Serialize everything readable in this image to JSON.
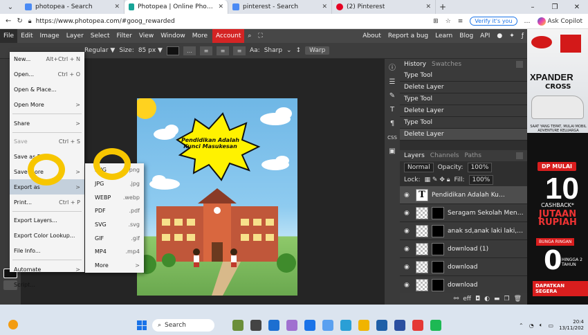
{
  "browser": {
    "tabs": [
      {
        "title": "photopea - Search",
        "color": "#4a8af4"
      },
      {
        "title": "Photopea | Online Photo Editor",
        "color": "#18a497",
        "active": true
      },
      {
        "title": "pinterest - Search",
        "color": "#4a8af4"
      },
      {
        "title": "(2) Pinterest",
        "color": "#e60023"
      }
    ],
    "url": "https://www.photopea.com/#goog_rewarded",
    "verify_label": "Verify it's you",
    "copilot_label": "Ask Copilot",
    "win_min": "–",
    "win_max": "❐",
    "win_close": "✕"
  },
  "menubar": {
    "items": [
      "File",
      "Edit",
      "Image",
      "Layer",
      "Select",
      "Filter",
      "View",
      "Window",
      "More"
    ],
    "account": "Account",
    "right_items": [
      "About",
      "Report a bug",
      "Learn",
      "Blog",
      "API"
    ]
  },
  "options": {
    "style": "Regular ▼",
    "size_label": "Size:",
    "size_value": "85 px ▼",
    "aa_label": "Aa:",
    "aa_value": "Sharp",
    "warp": "Warp",
    "color": "#111111"
  },
  "file_menu": {
    "items": [
      {
        "label": "New...",
        "shortcut": "Alt+Ctrl + N"
      },
      {
        "label": "Open...",
        "shortcut": "Ctrl + O"
      },
      {
        "label": "Open & Place...",
        "shortcut": ""
      },
      {
        "label": "Open More",
        "shortcut": ">"
      },
      {
        "label": "Share",
        "shortcut": ">"
      },
      {
        "label": "Save",
        "shortcut": "Ctrl + S",
        "disabled": true
      },
      {
        "label": "Save as PSD",
        "shortcut": ""
      },
      {
        "label": "Save more",
        "shortcut": ">"
      },
      {
        "label": "Export as",
        "shortcut": ">",
        "highlight": true
      },
      {
        "label": "Print...",
        "shortcut": "Ctrl + P"
      },
      {
        "label": "Export Layers...",
        "shortcut": ""
      },
      {
        "label": "Export Color Lookup...",
        "shortcut": ""
      },
      {
        "label": "File Info...",
        "shortcut": ""
      },
      {
        "label": "Automate",
        "shortcut": ">"
      },
      {
        "label": "Script...",
        "shortcut": ""
      }
    ]
  },
  "export_submenu": {
    "items": [
      {
        "label": "PNG",
        "ext": ".png"
      },
      {
        "label": "JPG",
        "ext": ".jpg"
      },
      {
        "label": "WEBP",
        "ext": ".webp"
      },
      {
        "label": "PDF",
        "ext": ".pdf"
      },
      {
        "label": "SVG",
        "ext": ".svg"
      },
      {
        "label": "GIF",
        "ext": ".gif"
      },
      {
        "label": "MP4",
        "ext": ".mp4"
      },
      {
        "label": "More",
        "ext": ">"
      }
    ]
  },
  "canvas": {
    "title_text": "Pendidikan Adalah Kunci Masukesan",
    "burst_color": "#fff200"
  },
  "history_panel": {
    "tabs": [
      "History",
      "Swatches"
    ],
    "items": [
      "Type Tool",
      "Delete Layer",
      "Type Tool",
      "Delete Layer",
      "Type Tool",
      "Delete Layer"
    ]
  },
  "layers_panel": {
    "tabs": [
      "Layers",
      "Channels",
      "Paths"
    ],
    "blend": "Normal",
    "opacity_label": "Opacity:",
    "opacity": "100%",
    "lock_label": "Lock:",
    "fill_label": "Fill:",
    "fill": "100%",
    "layers": [
      {
        "name": "Pendidikan Adalah Kunci",
        "type": "text",
        "selected": true
      },
      {
        "name": "Seragam Sekolah Meneg",
        "type": "image"
      },
      {
        "name": "anak sd,anak laki laki,kar",
        "type": "image"
      },
      {
        "name": "download (1)",
        "type": "image"
      },
      {
        "name": "download",
        "type": "image"
      },
      {
        "name": "download",
        "type": "image"
      }
    ],
    "footer": "eff"
  },
  "ad": {
    "brand": "XPANDER",
    "brand2": "CROSS",
    "tagline": "SAAT YANG TEPAT, MULAI MOBIL ADVENTURE KELUARGA",
    "dp_label": "DP MULAI",
    "dp_value": "10",
    "cashback": "CASHBACK*",
    "jutaan": "JUTAAN RUPIAH",
    "bunga": "BUNGA RINGAN",
    "zero": "0",
    "hingga": "HINGGA 2 TAHUN",
    "cta": "DAPATKAN SEGERA"
  },
  "taskbar": {
    "search": "Search",
    "time": "20:4",
    "date": "13/11/202"
  }
}
